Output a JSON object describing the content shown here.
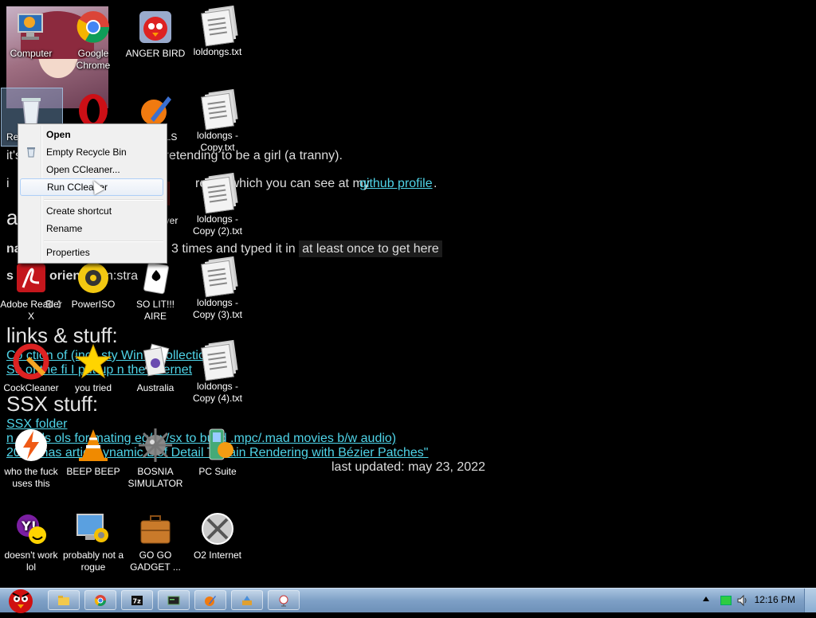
{
  "wallpaper": {
    "line_tranny": "it's a that rapes women by pretending to be a girl (a tranny).",
    "line_projects_prefix": "i",
    "line_projects_mid": "roject which you can see at my",
    "line_projects_link": "github profile",
    "line_projects_end": ".",
    "head_a": "a",
    "line_na_prefix": "na",
    "line_na_text": "3 times and typed it in",
    "line_na_hl": "at least once to get here",
    "line_orient_prefix": "s",
    "line_orient_bold": "orien",
    "line_orient_rest": "n:stra",
    "line_s_colon": "s :",
    "head_links": "links & stuff:",
    "link1": "Co  ction of  (incl.  sty Win  s Collection)",
    "link2": "So  of the fi  I put up  n the Internet",
    "head_ssx": "SSX stuff:",
    "link_ssx_folder": "SSX folder",
    "link_ssx_tools": "n  dtools  ols for  mating  eg/gx/sx to build .mpc/.mad movies b/w audio)",
    "link_ssx_paper": "20  camas  article  ynamic L  of Detail Terrain Rendering with Bézier Patches\"",
    "last_updated": "last updated: may 23, 2022"
  },
  "icons": [
    {
      "label": "Computer",
      "icon": "computer-icon"
    },
    {
      "label": "Google Chrome",
      "icon": "chrome-icon"
    },
    {
      "label": "ANGER BIRD",
      "icon": "angry-bird-icon"
    },
    {
      "label": "loldongs.txt",
      "icon": "text-file-icon"
    },
    {
      "label": "Re",
      "icon": "recycle-bin-icon"
    },
    {
      "label": "",
      "icon": "opera-icon"
    },
    {
      "label": "LS",
      "icon": "paint-icon"
    },
    {
      "label": "loldongs - Copy.txt",
      "icon": "text-file-icon"
    },
    {
      "label": "yer",
      "icon": "player-icon"
    },
    {
      "label": "loldongs - Copy (2).txt",
      "icon": "text-file-icon"
    },
    {
      "label": "Adobe Reader X",
      "icon": "adobe-reader-icon"
    },
    {
      "label": "PowerISO",
      "icon": "poweriso-icon"
    },
    {
      "label": "SO LIT!!! AIRE",
      "icon": "solitaire-icon"
    },
    {
      "label": "loldongs - Copy (3).txt",
      "icon": "text-file-icon"
    },
    {
      "label": "CockCleaner",
      "icon": "ccleaner-icon"
    },
    {
      "label": "you tried",
      "icon": "star-icon"
    },
    {
      "label": "Australia",
      "icon": "spider-icon"
    },
    {
      "label": "loldongs - Copy (4).txt",
      "icon": "text-file-icon"
    },
    {
      "label": "who the fuck uses this",
      "icon": "flash-icon"
    },
    {
      "label": "BEEP BEEP",
      "icon": "vlc-icon"
    },
    {
      "label": "BOSNIA SIMULATOR",
      "icon": "mine-icon"
    },
    {
      "label": "PC Suite",
      "icon": "pc-suite-icon"
    },
    {
      "label": "doesn't work lol",
      "icon": "yahoo-icon"
    },
    {
      "label": "probably not a rogue",
      "icon": "rogue-icon"
    },
    {
      "label": "GO GO GADGET ...",
      "icon": "briefcase-icon"
    },
    {
      "label": "O2 Internet",
      "icon": "o2-icon"
    }
  ],
  "context_menu": {
    "open": "Open",
    "empty_recycle_bin": "Empty Recycle Bin",
    "open_ccleaner": "Open CCleaner...",
    "run_ccleaner": "Run CCleaner",
    "create_shortcut": "Create shortcut",
    "rename": "Rename",
    "properties": "Properties"
  },
  "taskbar": {
    "clock": "12:16 PM",
    "pinned": [
      "explorer-icon",
      "chrome-icon",
      "7zip-icon",
      "terminal-icon",
      "paint-icon",
      "tools-icon",
      "network-icon"
    ]
  },
  "colors": {
    "link": "#4fd4e8",
    "taskbar": "#7ea0c6",
    "menu_bg": "#f0f0f0"
  }
}
